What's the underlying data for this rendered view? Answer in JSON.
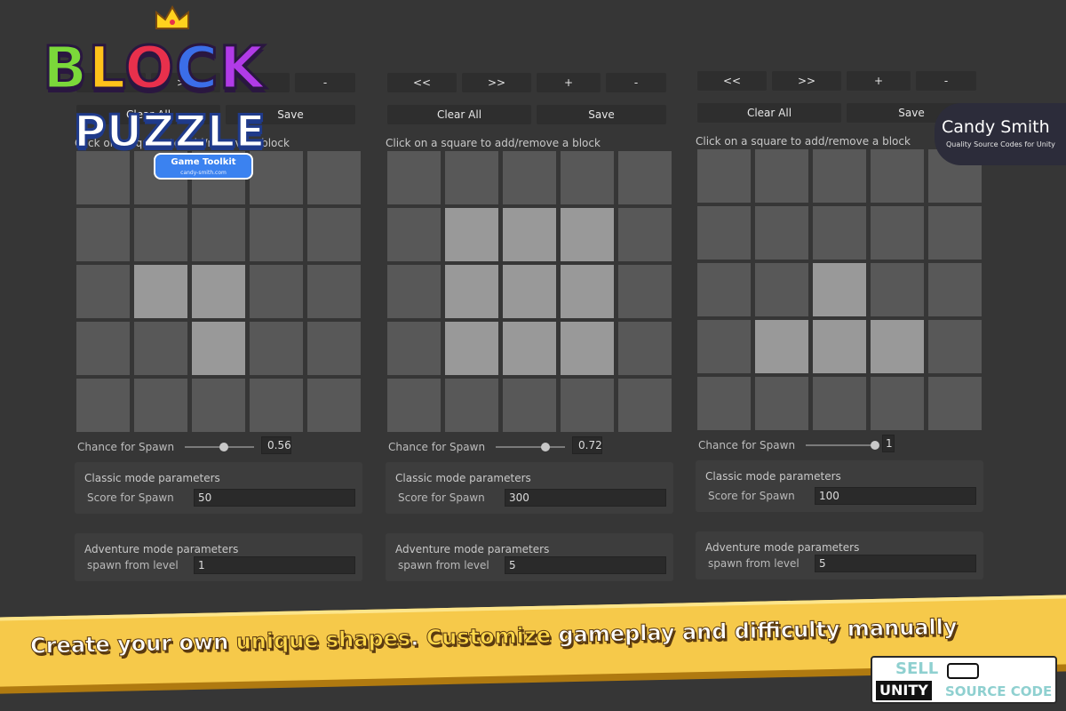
{
  "logo": {
    "word1": "BLOCK",
    "word2": "PUZZLE",
    "tag_title": "Game Toolkit",
    "tag_url": "candy-smith.com"
  },
  "brand": {
    "name": "Candy Smith",
    "tagline": "Quality Source Codes for Unity"
  },
  "panels": [
    {
      "nav": {
        "prev": "<<",
        "next": ">>",
        "plus": "+",
        "minus": "-"
      },
      "clear_all": "Clear All",
      "save": "Save",
      "hint": "Click on a square to add/remove a block",
      "grid_on": [
        [
          0,
          0,
          0,
          0,
          0
        ],
        [
          0,
          0,
          0,
          0,
          0
        ],
        [
          0,
          1,
          1,
          0,
          0
        ],
        [
          0,
          0,
          1,
          0,
          0
        ],
        [
          0,
          0,
          0,
          0,
          0
        ]
      ],
      "chance_label": "Chance for Spawn",
      "chance_value": "0.56",
      "chance_fraction": 0.56,
      "classic_title": "Classic mode parameters",
      "score_label": "Score for Spawn",
      "score_value": "50",
      "adventure_title": "Adventure mode parameters",
      "level_label": "spawn from level",
      "level_value": "1"
    },
    {
      "nav": {
        "prev": "<<",
        "next": ">>",
        "plus": "+",
        "minus": "-"
      },
      "clear_all": "Clear All",
      "save": "Save",
      "hint": "Click on a square to add/remove a block",
      "grid_on": [
        [
          0,
          0,
          0,
          0,
          0
        ],
        [
          0,
          1,
          1,
          1,
          0
        ],
        [
          0,
          1,
          1,
          1,
          0
        ],
        [
          0,
          1,
          1,
          1,
          0
        ],
        [
          0,
          0,
          0,
          0,
          0
        ]
      ],
      "chance_label": "Chance for Spawn",
      "chance_value": "0.72",
      "chance_fraction": 0.72,
      "classic_title": "Classic mode parameters",
      "score_label": "Score for Spawn",
      "score_value": "300",
      "adventure_title": "Adventure mode parameters",
      "level_label": "spawn from level",
      "level_value": "5"
    },
    {
      "nav": {
        "prev": "<<",
        "next": ">>",
        "plus": "+",
        "minus": "-"
      },
      "clear_all": "Clear All",
      "save": "Save",
      "hint": "Click on a square to add/remove a block",
      "grid_on": [
        [
          0,
          0,
          0,
          0,
          0
        ],
        [
          0,
          0,
          0,
          0,
          0
        ],
        [
          0,
          0,
          1,
          0,
          0
        ],
        [
          0,
          1,
          1,
          1,
          0
        ],
        [
          0,
          0,
          0,
          0,
          0
        ]
      ],
      "chance_label": "Chance for Spawn",
      "chance_value": "1",
      "chance_fraction": 1.0,
      "classic_title": "Classic mode parameters",
      "score_label": "Score for Spawn",
      "score_value": "100",
      "adventure_title": "Adventure mode parameters",
      "level_label": "spawn from level",
      "level_value": "5"
    }
  ],
  "banner": {
    "part1": "Create your own ",
    "part2": "unique shapes",
    "part3": ". ",
    "part4": "Customize",
    "part5": " gameplay and difficulty manually"
  },
  "sell": {
    "top": "SELL",
    "left": "UNITY",
    "right": "SOURCE CODE"
  }
}
